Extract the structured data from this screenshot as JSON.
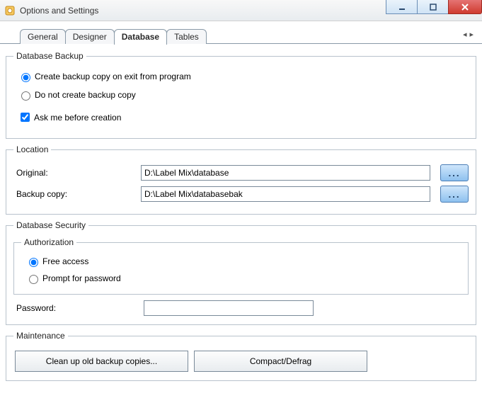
{
  "window": {
    "title": "Options and Settings"
  },
  "tabs": {
    "items": [
      {
        "label": "General"
      },
      {
        "label": "Designer"
      },
      {
        "label": "Database"
      },
      {
        "label": "Tables"
      }
    ],
    "active_index": 2
  },
  "backup": {
    "legend": "Database Backup",
    "opt_create": "Create backup copy on exit from program",
    "opt_none": "Do not create backup copy",
    "ask_label": "Ask me before creation",
    "selected": "create",
    "ask_checked": true
  },
  "location": {
    "legend": "Location",
    "original_label": "Original:",
    "original_value": "D:\\Label Mix\\database",
    "backup_label": "Backup copy:",
    "backup_value": "D:\\Label Mix\\databasebak",
    "browse_label": "..."
  },
  "security": {
    "legend": "Database Security",
    "auth_legend": "Authorization",
    "opt_free": "Free access",
    "opt_prompt": "Prompt for password",
    "selected": "free",
    "password_label": "Password:",
    "password_value": ""
  },
  "maintenance": {
    "legend": "Maintenance",
    "cleanup_label": "Clean up old backup copies...",
    "compact_label": "Compact/Defrag"
  }
}
